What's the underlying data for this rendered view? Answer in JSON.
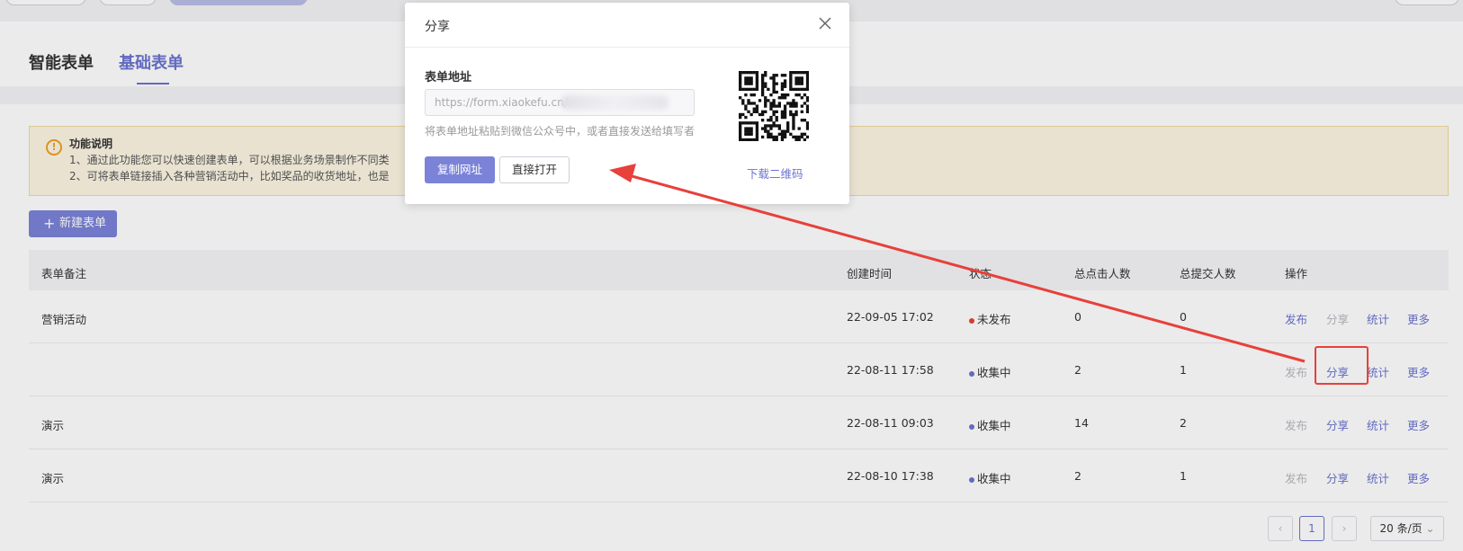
{
  "tabs": [
    {
      "label": "智能表单",
      "active": false
    },
    {
      "label": "基础表单",
      "active": true
    }
  ],
  "notice": {
    "title": "功能说明",
    "line1": "1、通过此功能您可以快速创建表单，可以根据业务场景制作不同类",
    "line2": "2、可将表单链接插入各种营销活动中，比如奖品的收货地址，也是"
  },
  "new_form_button": "新建表单",
  "table": {
    "headers": [
      "表单备注",
      "创建时间",
      "状态",
      "总点击人数",
      "总提交人数",
      "操作"
    ],
    "rows": [
      {
        "note": "营销活动",
        "created": "22-09-05 17:02",
        "status": "未发布",
        "clicks": "0",
        "submits": "0",
        "publish_enabled": true,
        "share_enabled": false
      },
      {
        "note": "",
        "created": "22-08-11 17:58",
        "status": "收集中",
        "clicks": "2",
        "submits": "1",
        "publish_enabled": false,
        "share_enabled": true
      },
      {
        "note": "演示",
        "created": "22-08-11 09:03",
        "status": "收集中",
        "clicks": "14",
        "submits": "2",
        "publish_enabled": false,
        "share_enabled": true
      },
      {
        "note": "演示",
        "created": "22-08-10 17:38",
        "status": "收集中",
        "clicks": "2",
        "submits": "1",
        "publish_enabled": false,
        "share_enabled": true
      }
    ],
    "actions": {
      "publish": "发布",
      "share": "分享",
      "stats": "统计",
      "more": "更多"
    }
  },
  "pagination": {
    "current_page": "1",
    "page_size": "20 条/页"
  },
  "modal": {
    "title": "分享",
    "field_label": "表单地址",
    "url_value": "https://form.xiaokefu.cn/",
    "hint": "将表单地址粘贴到微信公众号中，或者直接发送给填写者",
    "copy_button": "复制网址",
    "open_button": "直接打开",
    "download_qr": "下载二维码"
  },
  "colors": {
    "accent": "#6b74d0",
    "button_primary": "#7b83d8",
    "status_unpublished": "#e8403a",
    "status_collecting": "#6b74d0",
    "annotation": "#e8403a"
  }
}
